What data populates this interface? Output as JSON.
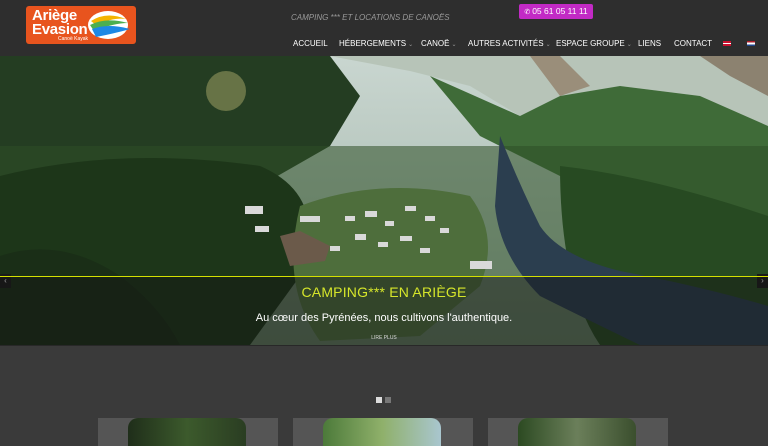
{
  "logo": {
    "line1": "Ariège",
    "line2": "Evasion",
    "line3": "Canoë Kayak"
  },
  "header": {
    "tagline": "CAMPING *** ET LOCATIONS DE CANOËS",
    "phone": "05 61 05 11 11"
  },
  "nav": {
    "items": [
      {
        "label": "ACCUEIL",
        "has_caret": false
      },
      {
        "label": "HÉBERGEMENTS",
        "has_caret": true
      },
      {
        "label": "CANOË",
        "has_caret": true
      },
      {
        "label": "AUTRES ACTIVITÉS",
        "has_caret": true
      },
      {
        "label": "ESPACE GROUPE",
        "has_caret": true
      },
      {
        "label": "LIENS",
        "has_caret": false
      },
      {
        "label": "CONTACT",
        "has_caret": false
      }
    ],
    "caret": "⌄"
  },
  "hero": {
    "title": "CAMPING*** EN ARIÈGE",
    "subtitle": "Au cœur des Pyrénées, nous cultivons l'authentique.",
    "more": "LIRE PLUS",
    "prev_icon": "‹",
    "next_icon": "›"
  },
  "slider": {
    "current": 1,
    "total": 2
  },
  "colors": {
    "accent": "#d6e62a",
    "phone_bg": "#c22ac5",
    "logo_bg": "#e8541e"
  }
}
